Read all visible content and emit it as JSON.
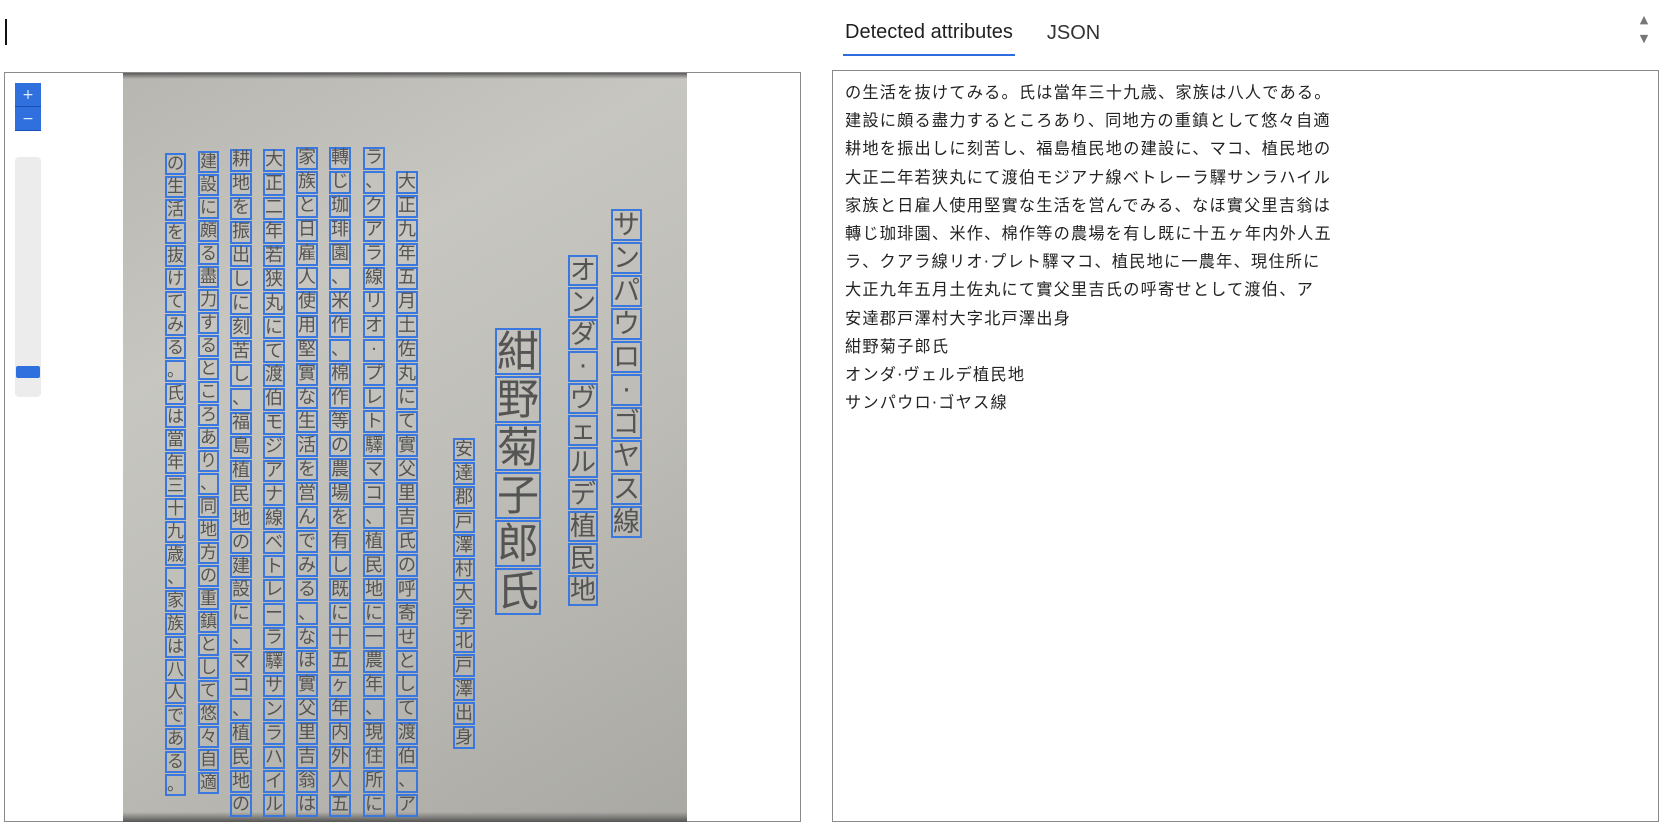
{
  "tabs": [
    {
      "label": "Detected attributes",
      "active": true
    },
    {
      "label": "JSON",
      "active": false
    }
  ],
  "zoom": {
    "in_label": "+",
    "out_label": "−",
    "level": 0.03
  },
  "accent_color": "#2f6fde",
  "icons": {
    "spinner_up": "triangle-up-icon",
    "spinner_down": "triangle-down-icon"
  },
  "ocr_lines": [
    "の生活を抜けてみる。氏は當年三十九歳、家族は八人である。",
    "建設に頗る盡力するところあり、同地方の重鎮として悠々自適",
    "耕地を振出しに刻苦し、福島植民地の建設に、マコ、植民地の",
    "大正二年若狭丸にて渡伯モジアナ線ベトレーラ驛サンラハイル",
    "家族と日雇人使用堅實な生活を営んでみる、なほ實父里吉翁は",
    "轉じ珈琲園、米作、棉作等の農場を有し既に十五ヶ年内外人五",
    "ラ、クアラ線リオ·プレト驛マコ、植民地に一農年、現住所に",
    "大正九年五月土佐丸にて實父里吉氏の呼寄せとして渡伯、ア",
    "安達郡戸澤村大字北戸澤出身",
    "紺野菊子郎氏",
    "オンダ·ヴェルデ植民地",
    "サンパウロ·ゴヤス線"
  ]
}
